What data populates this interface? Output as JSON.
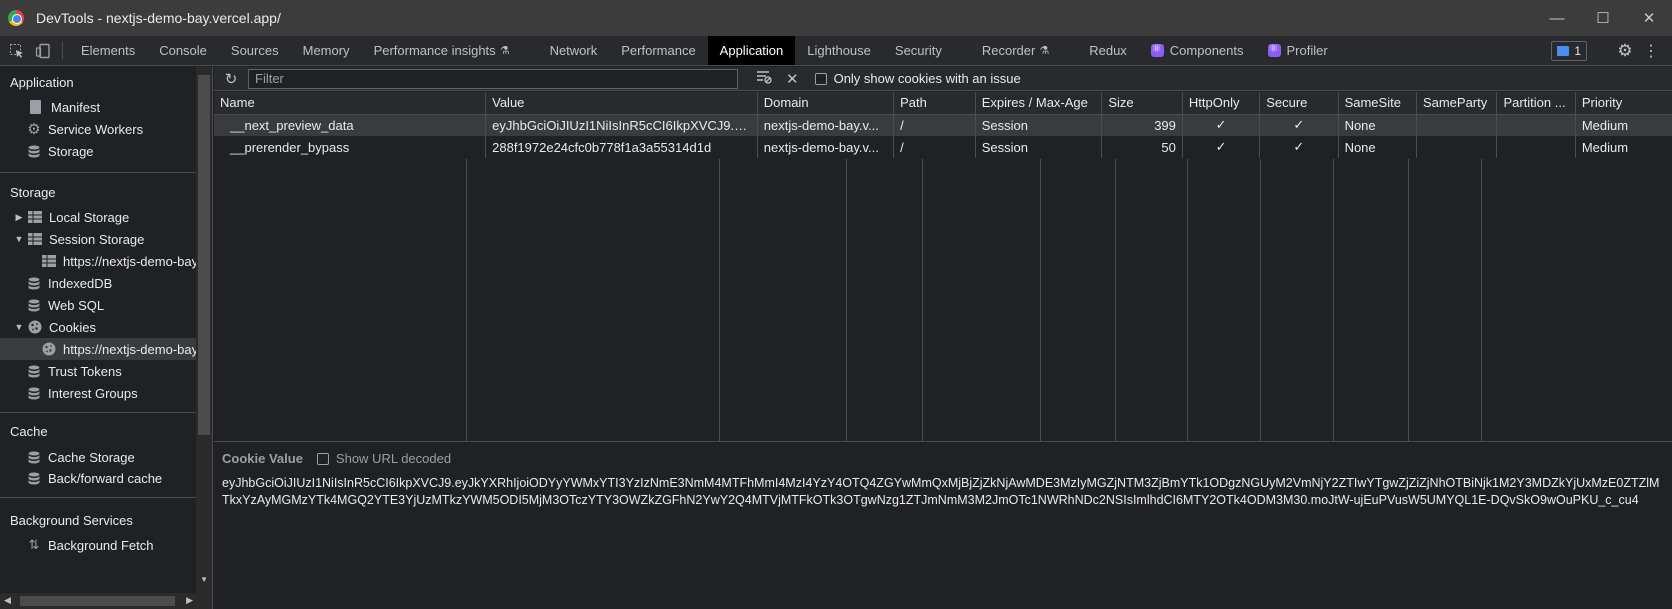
{
  "window": {
    "title": "DevTools - nextjs-demo-bay.vercel.app/",
    "controls": [
      "—",
      "☐",
      "✕"
    ]
  },
  "tabs": [
    {
      "label": "Elements"
    },
    {
      "label": "Console"
    },
    {
      "label": "Sources"
    },
    {
      "label": "Memory"
    },
    {
      "label": "Performance insights",
      "flask": true
    },
    {
      "label": "Network"
    },
    {
      "label": "Performance"
    },
    {
      "label": "Application",
      "active": true
    },
    {
      "label": "Lighthouse"
    },
    {
      "label": "Security"
    },
    {
      "label": "Recorder",
      "flask": true
    },
    {
      "label": "Redux"
    },
    {
      "label": "Components",
      "react": true
    },
    {
      "label": "Profiler",
      "react": true
    }
  ],
  "issues_count": "1",
  "sidebar": {
    "application": {
      "header": "Application",
      "items": [
        "Manifest",
        "Service Workers",
        "Storage"
      ]
    },
    "storage": {
      "header": "Storage",
      "items": [
        "Local Storage",
        "Session Storage",
        "https://nextjs-demo-bay.vercel.app",
        "IndexedDB",
        "Web SQL",
        "Cookies",
        "https://nextjs-demo-bay.vercel.app",
        "Trust Tokens",
        "Interest Groups"
      ]
    },
    "cache": {
      "header": "Cache",
      "items": [
        "Cache Storage",
        "Back/forward cache"
      ]
    },
    "background": {
      "header": "Background Services",
      "items": [
        "Background Fetch"
      ]
    }
  },
  "toolbar": {
    "filter_placeholder": "Filter",
    "only_issues_label": "Only show cookies with an issue"
  },
  "table": {
    "columns": [
      "Name",
      "Value",
      "Domain",
      "Path",
      "Expires / Max-Age",
      "Size",
      "HttpOnly",
      "Secure",
      "SameSite",
      "SameParty",
      "Partition ...",
      "Priority"
    ],
    "rows": [
      [
        "__next_preview_data",
        "eyJhbGciOiJIUzI1NiIsInR5cCI6IkpXVCJ9.e...",
        "nextjs-demo-bay.v...",
        "/",
        "Session",
        "399",
        "✓",
        "✓",
        "None",
        "",
        "",
        "Medium"
      ],
      [
        "__prerender_bypass",
        "288f1972e24cfc0b778f1a3a55314d1d",
        "nextjs-demo-bay.v...",
        "/",
        "Session",
        "50",
        "✓",
        "✓",
        "None",
        "",
        "",
        "Medium"
      ]
    ]
  },
  "cookie_value": {
    "title": "Cookie Value",
    "show_decoded_label": "Show URL decoded",
    "value": "eyJhbGciOiJIUzI1NiIsInR5cCI6IkpXVCJ9.eyJkYXRhIjoiODYyYWMxYTI3YzIzNmE3NmM4MTFhMmI4MzI4YzY4OTQ4ZGYwMmQxMjBjZjZkNjAwMDE3MzIyMGZjNTM3ZjBmYTk1ODgzNGUyM2VmNjY2ZTIwYTgwZjZiZjNhOTBiNjk1M2Y3MDZkYjUxMzE0ZTZlMTkxYzAyMGMzYTk4MGQ2YTE3YjUzMTkzYWM5ODI5MjM3OTczYTY3OWZkZGFhN2YwY2Q4MTVjMTFkOTk3OTgwNzg1ZTJmNmM3M2JmOTc1NWRhNDc2NSIsImlhdCI6MTY2OTk4ODM3M30.moJtW-ujEuPVusW5UMYQL1E-DQvSkO9wOuPKU_c_cu4"
  }
}
